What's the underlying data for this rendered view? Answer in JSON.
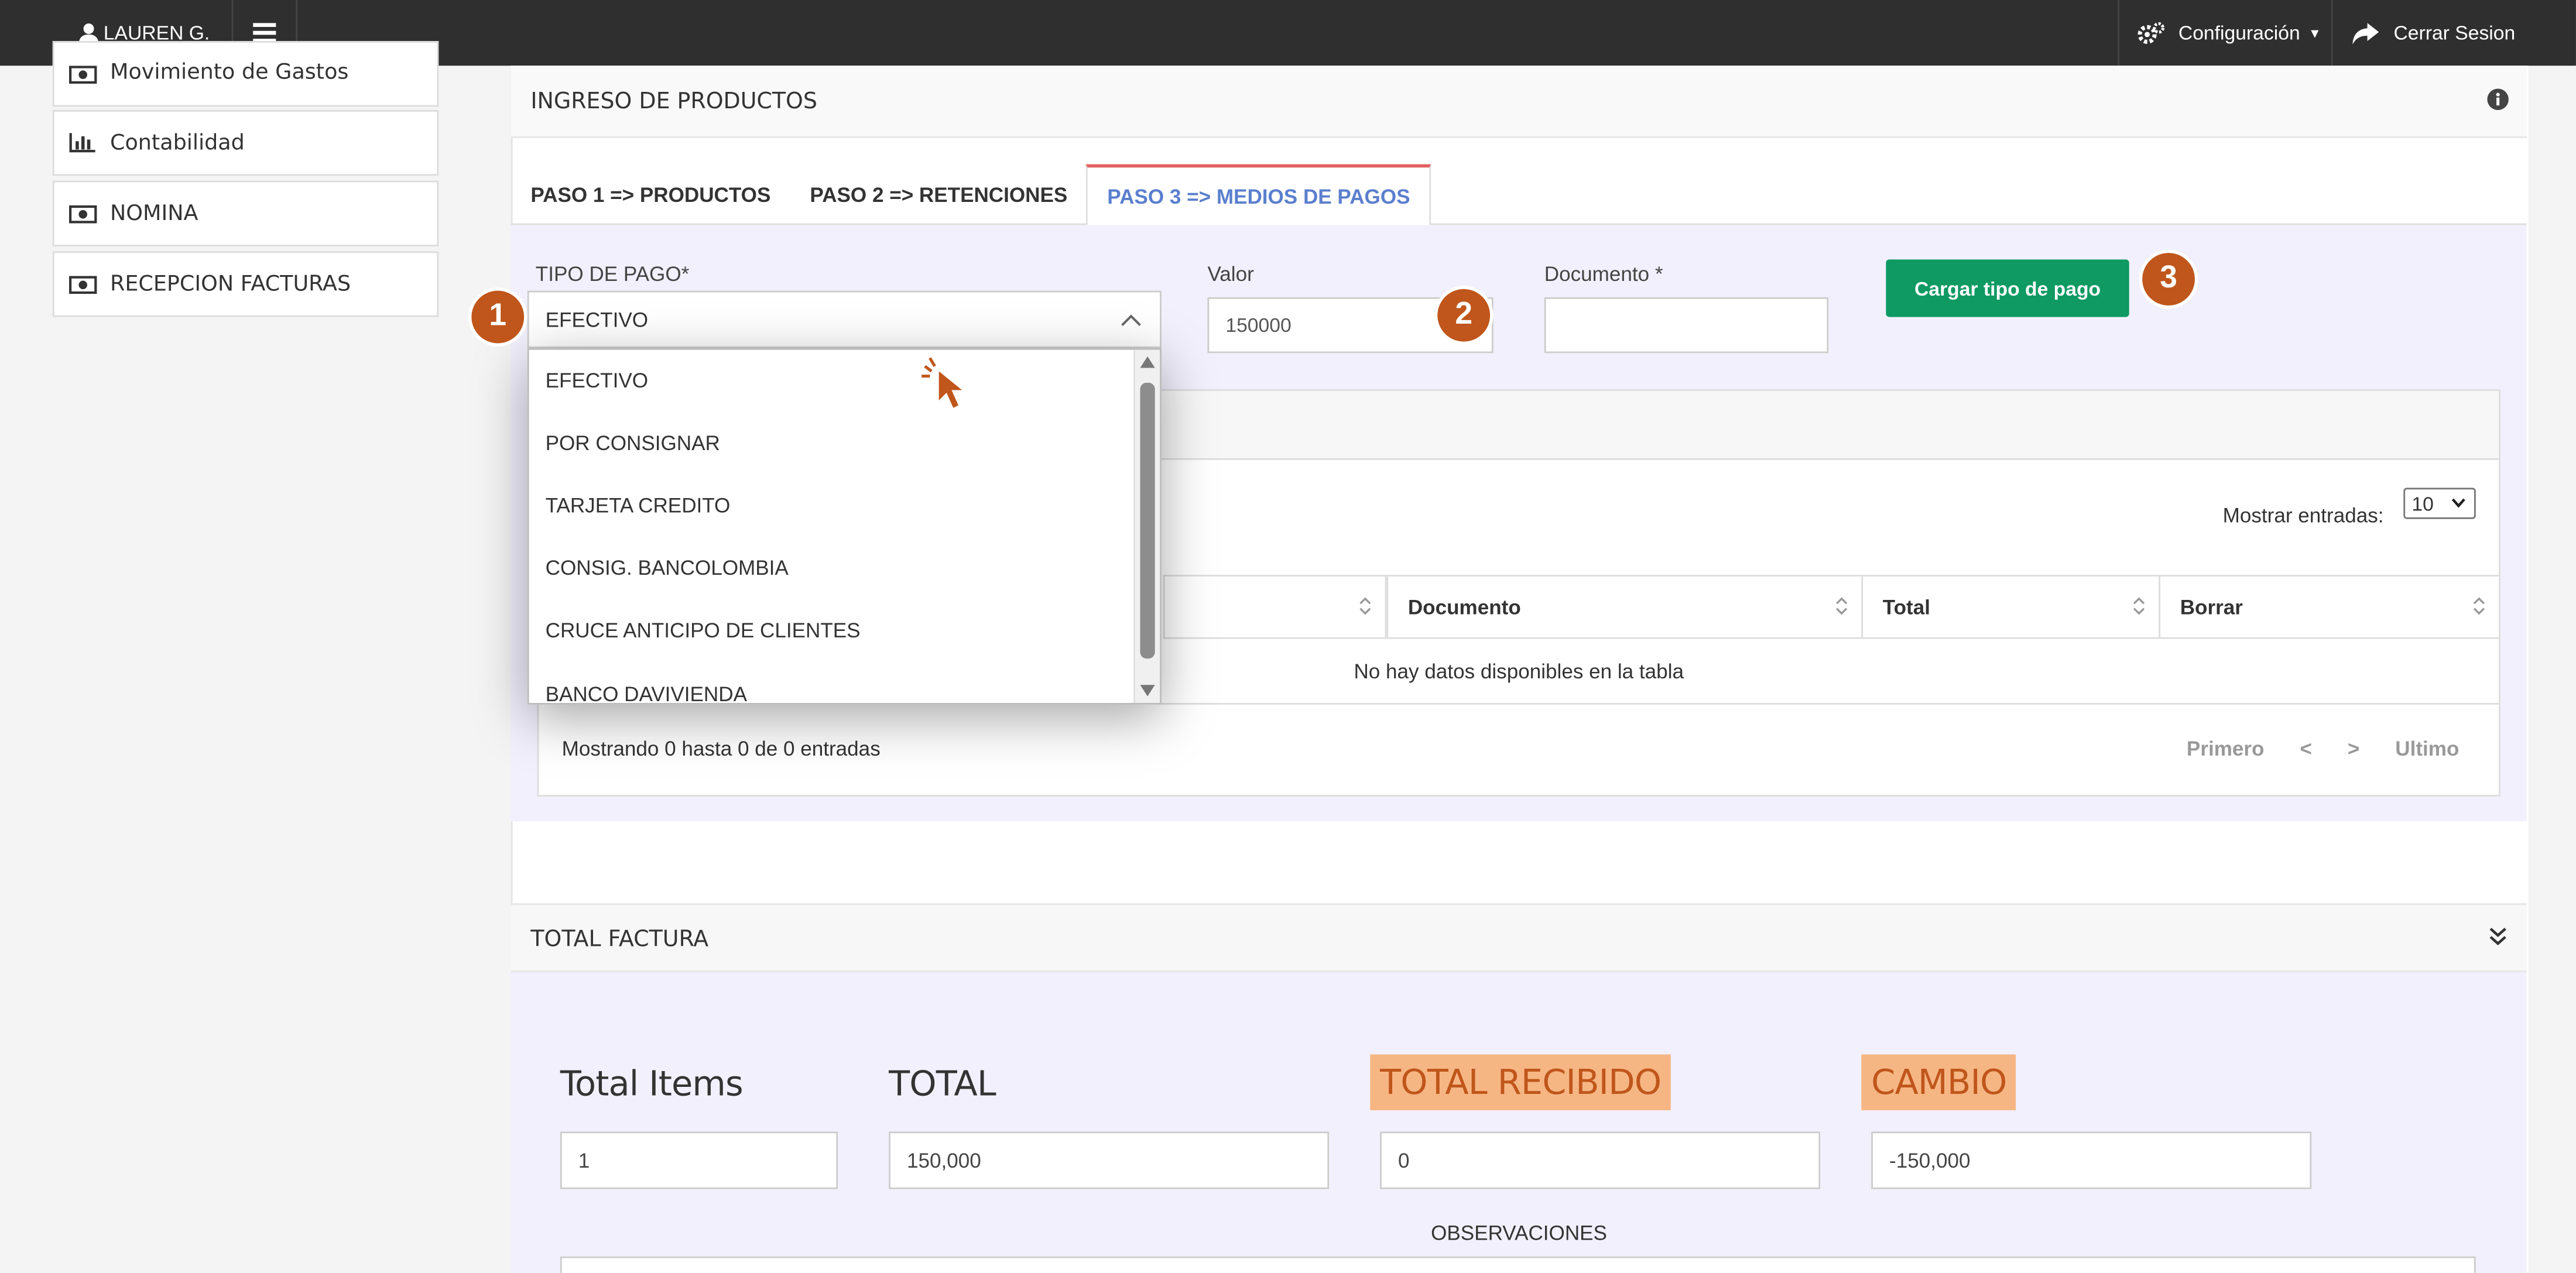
{
  "topbar": {
    "user_name": "LAUREN G.",
    "config_label": "Configuración",
    "logout_label": "Cerrar Sesion"
  },
  "sidebar": {
    "items": [
      {
        "label": "Movimiento de Gastos",
        "icon": "money-icon"
      },
      {
        "label": "Contabilidad",
        "icon": "bar-chart-icon"
      },
      {
        "label": "NOMINA",
        "icon": "money-icon"
      },
      {
        "label": "RECEPCION FACTURAS",
        "icon": "money-icon"
      }
    ]
  },
  "panel": {
    "title": "INGRESO DE PRODUCTOS",
    "tabs": [
      {
        "label": "PASO 1 => PRODUCTOS"
      },
      {
        "label": "PASO 2 => RETENCIONES"
      },
      {
        "label": "PASO 3 => MEDIOS DE PAGOS",
        "active": true
      }
    ]
  },
  "payment_form": {
    "tipo_label": "TIPO DE PAGO*",
    "tipo_value": "EFECTIVO",
    "valor_label": "Valor",
    "valor_value": "150000",
    "documento_label": "Documento *",
    "documento_value": "",
    "submit_label": "Cargar tipo de pago"
  },
  "dropdown": {
    "options": [
      "EFECTIVO",
      "POR CONSIGNAR",
      "TARJETA CREDITO",
      "CONSIG. BANCOLOMBIA",
      "CRUCE ANTICIPO DE CLIENTES",
      "BANCO DAVIVIENDA"
    ]
  },
  "badges": {
    "one": "1",
    "two": "2",
    "three": "3"
  },
  "table": {
    "show_entries_label": "Mostrar entradas:",
    "page_size": "10",
    "columns": [
      "Documento",
      "Total",
      "Borrar"
    ],
    "empty_message": "No hay datos disponibles en la tabla",
    "info": "Mostrando 0 hasta 0 de 0 entradas",
    "pager": {
      "first": "Primero",
      "prev": "<",
      "next": ">",
      "last": "Ultimo"
    }
  },
  "total_factura": {
    "title": "TOTAL FACTURA",
    "total_items_label": "Total Items",
    "total_items_value": "1",
    "total_label": "TOTAL",
    "total_value": "150,000",
    "recibido_label": "TOTAL RECIBIDO",
    "recibido_value": "0",
    "cambio_label": "CAMBIO",
    "cambio_value": "-150,000",
    "observaciones_label": "OBSERVACIONES"
  },
  "colors": {
    "topbar": "#2f2f2f",
    "accent_green": "#0e9a62",
    "badge_orange": "#c0561b",
    "highlight": "#f6b684",
    "active_tab_text": "#5b7fce",
    "active_tab_border": "#e26060",
    "form_bg": "#f2f0fd"
  }
}
